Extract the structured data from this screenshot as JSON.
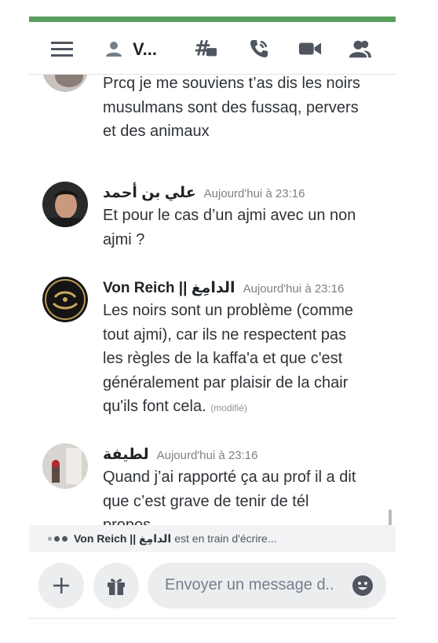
{
  "header": {
    "channel_name": "V...",
    "icons": [
      "hamburger-menu-icon",
      "user-icon",
      "threads-icon",
      "voice-call-icon",
      "video-call-icon",
      "members-icon"
    ]
  },
  "messages": [
    {
      "author": "",
      "timestamp": "",
      "lines": [
        "Prcq je me souviens t’as dis les noirs",
        "musulmans sont des fussaq, pervers",
        "et des animaux"
      ]
    },
    {
      "author": "علي بن أحمد",
      "timestamp": "Aujourd'hui à 23:16",
      "lines": [
        "Et pour le cas d’un ajmi avec un non",
        "ajmi ?"
      ]
    },
    {
      "author": "Von Reich || الدامِغ",
      "timestamp": "Aujourd'hui à 23:16",
      "lines": [
        "Les noirs sont un problème (comme",
        "tout ajmi), car ils ne respectent pas",
        "les règles de la kaffa'a et que c'est",
        "généralement par plaisir de la chair",
        "qu'ils font cela."
      ],
      "edited": "(modifié)"
    },
    {
      "author": "لطيفة",
      "timestamp": "Aujourd'hui à 23:16",
      "lines": [
        "Quand j’ai rapporté ça au prof il a dit",
        "que c’est grave de tenir de tél",
        "propos"
      ]
    }
  ],
  "typing": {
    "user": "Von Reich || الدامِغ",
    "text": "est en train d'écrire..."
  },
  "composer": {
    "placeholder": "Envoyer un message d..",
    "add_icon": "plus-icon",
    "gift_icon": "gift-icon",
    "emoji_icon": "emoji-icon"
  },
  "colors": {
    "accent_bar": "#5a9e5e",
    "text": "#2e3338",
    "muted": "#7b8187",
    "input_bg": "#ebedef"
  }
}
